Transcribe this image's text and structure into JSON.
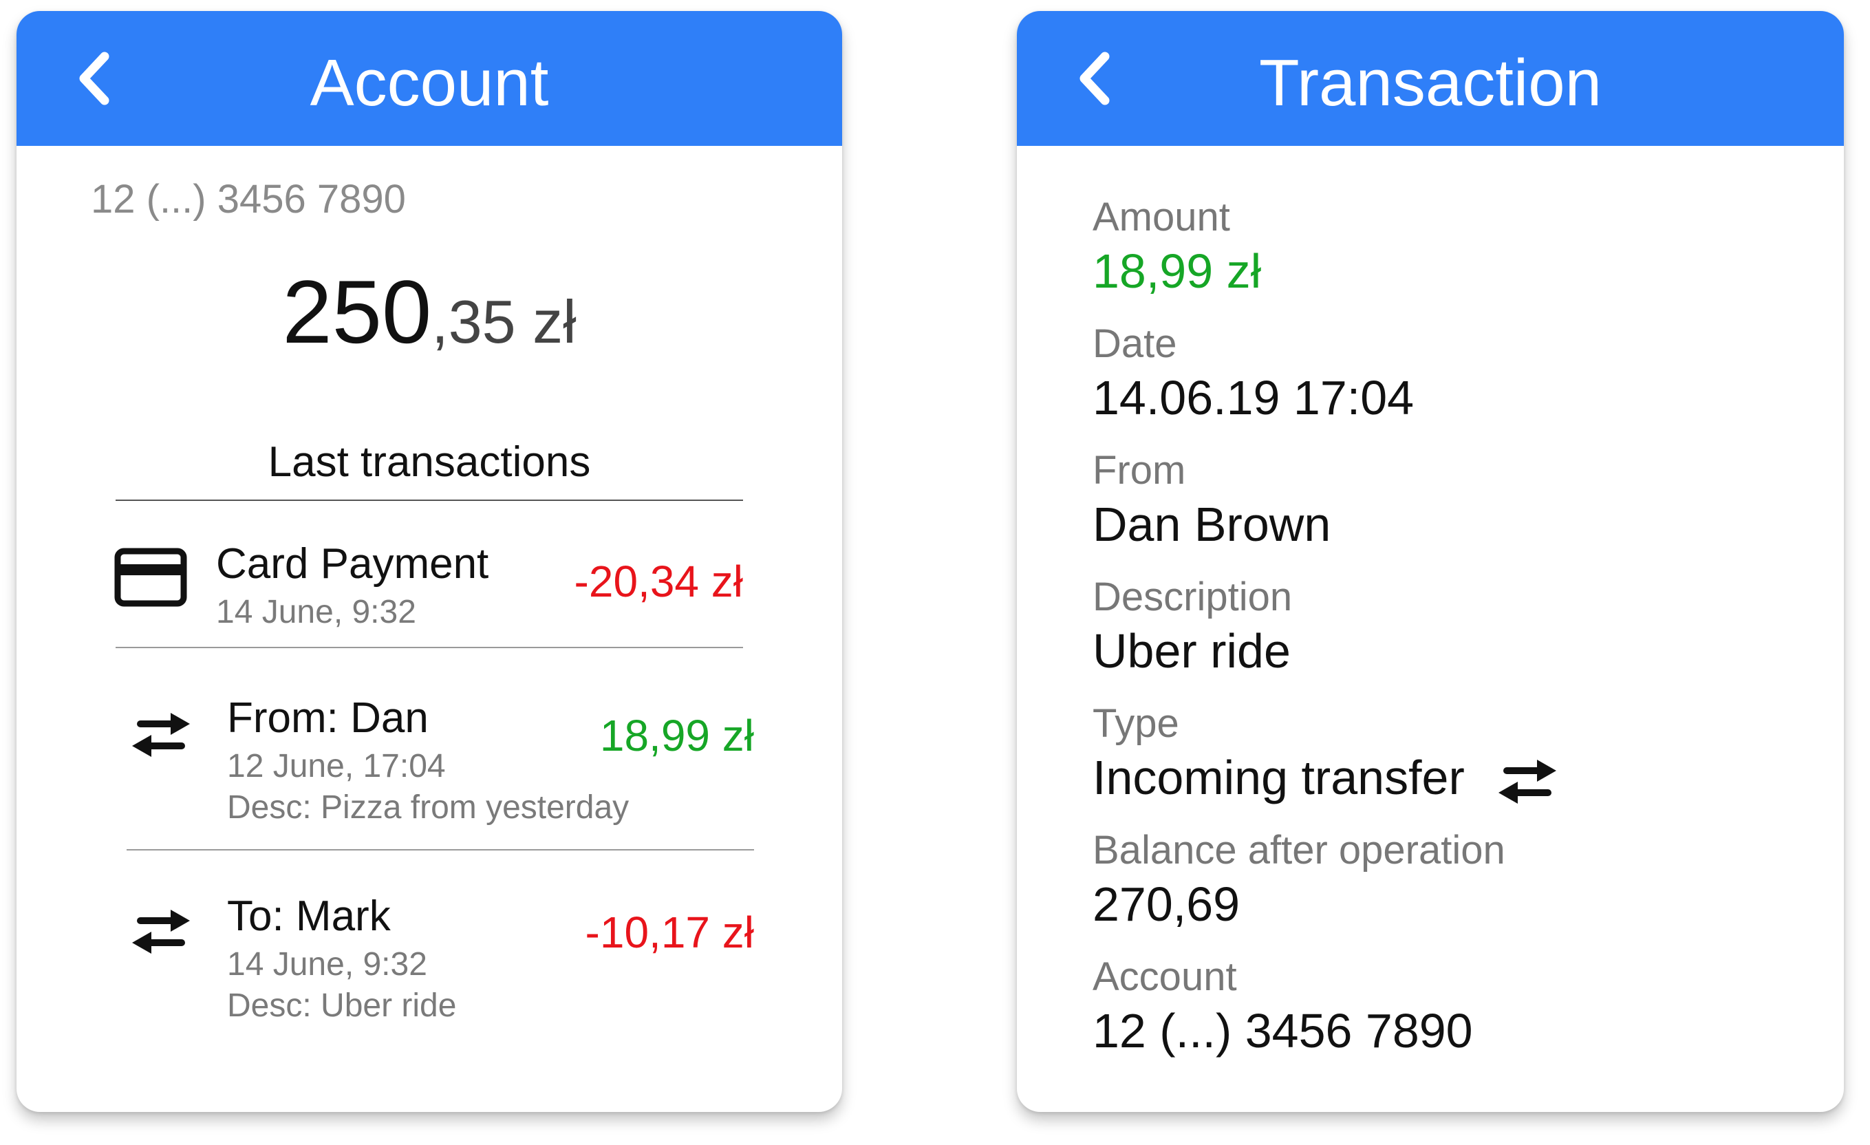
{
  "colors": {
    "header_blue": "#2F7FF8",
    "negative": "#E8141B",
    "positive": "#16A626",
    "muted_text": "#7A7A7A"
  },
  "account_screen": {
    "header": {
      "back_icon": "chevron-left-icon",
      "title": "Account"
    },
    "account_number": "12 (...) 3456 7890",
    "balance": {
      "integer": "250",
      "decimal_currency": ",35 zł"
    },
    "section_title": "Last transactions",
    "transactions": [
      {
        "icon": "credit-card-icon",
        "title": "Card Payment",
        "date": "14 June, 9:32",
        "description": "",
        "amount": "-20,34 zł",
        "amount_type": "negative"
      },
      {
        "icon": "transfer-arrows-icon",
        "title": "From: Dan",
        "date": "12 June, 17:04",
        "description": "Desc: Pizza from yesterday",
        "amount": "18,99 zł",
        "amount_type": "positive"
      },
      {
        "icon": "transfer-arrows-icon",
        "title": "To: Mark",
        "date": "14 June, 9:32",
        "description": "Desc: Uber ride",
        "amount": "-10,17 zł",
        "amount_type": "negative"
      }
    ]
  },
  "transaction_screen": {
    "header": {
      "back_icon": "chevron-left-icon",
      "title": "Transaction"
    },
    "fields": {
      "amount": {
        "label": "Amount",
        "value": "18,99 zł"
      },
      "date": {
        "label": "Date",
        "value": "14.06.19 17:04"
      },
      "from": {
        "label": "From",
        "value": "Dan Brown"
      },
      "description": {
        "label": "Description",
        "value": "Uber ride"
      },
      "type": {
        "label": "Type",
        "value": "Incoming transfer",
        "icon": "transfer-arrows-icon"
      },
      "balance_after": {
        "label": "Balance after operation",
        "value": "270,69"
      },
      "account": {
        "label": "Account",
        "value": "12 (...) 3456 7890"
      }
    }
  }
}
